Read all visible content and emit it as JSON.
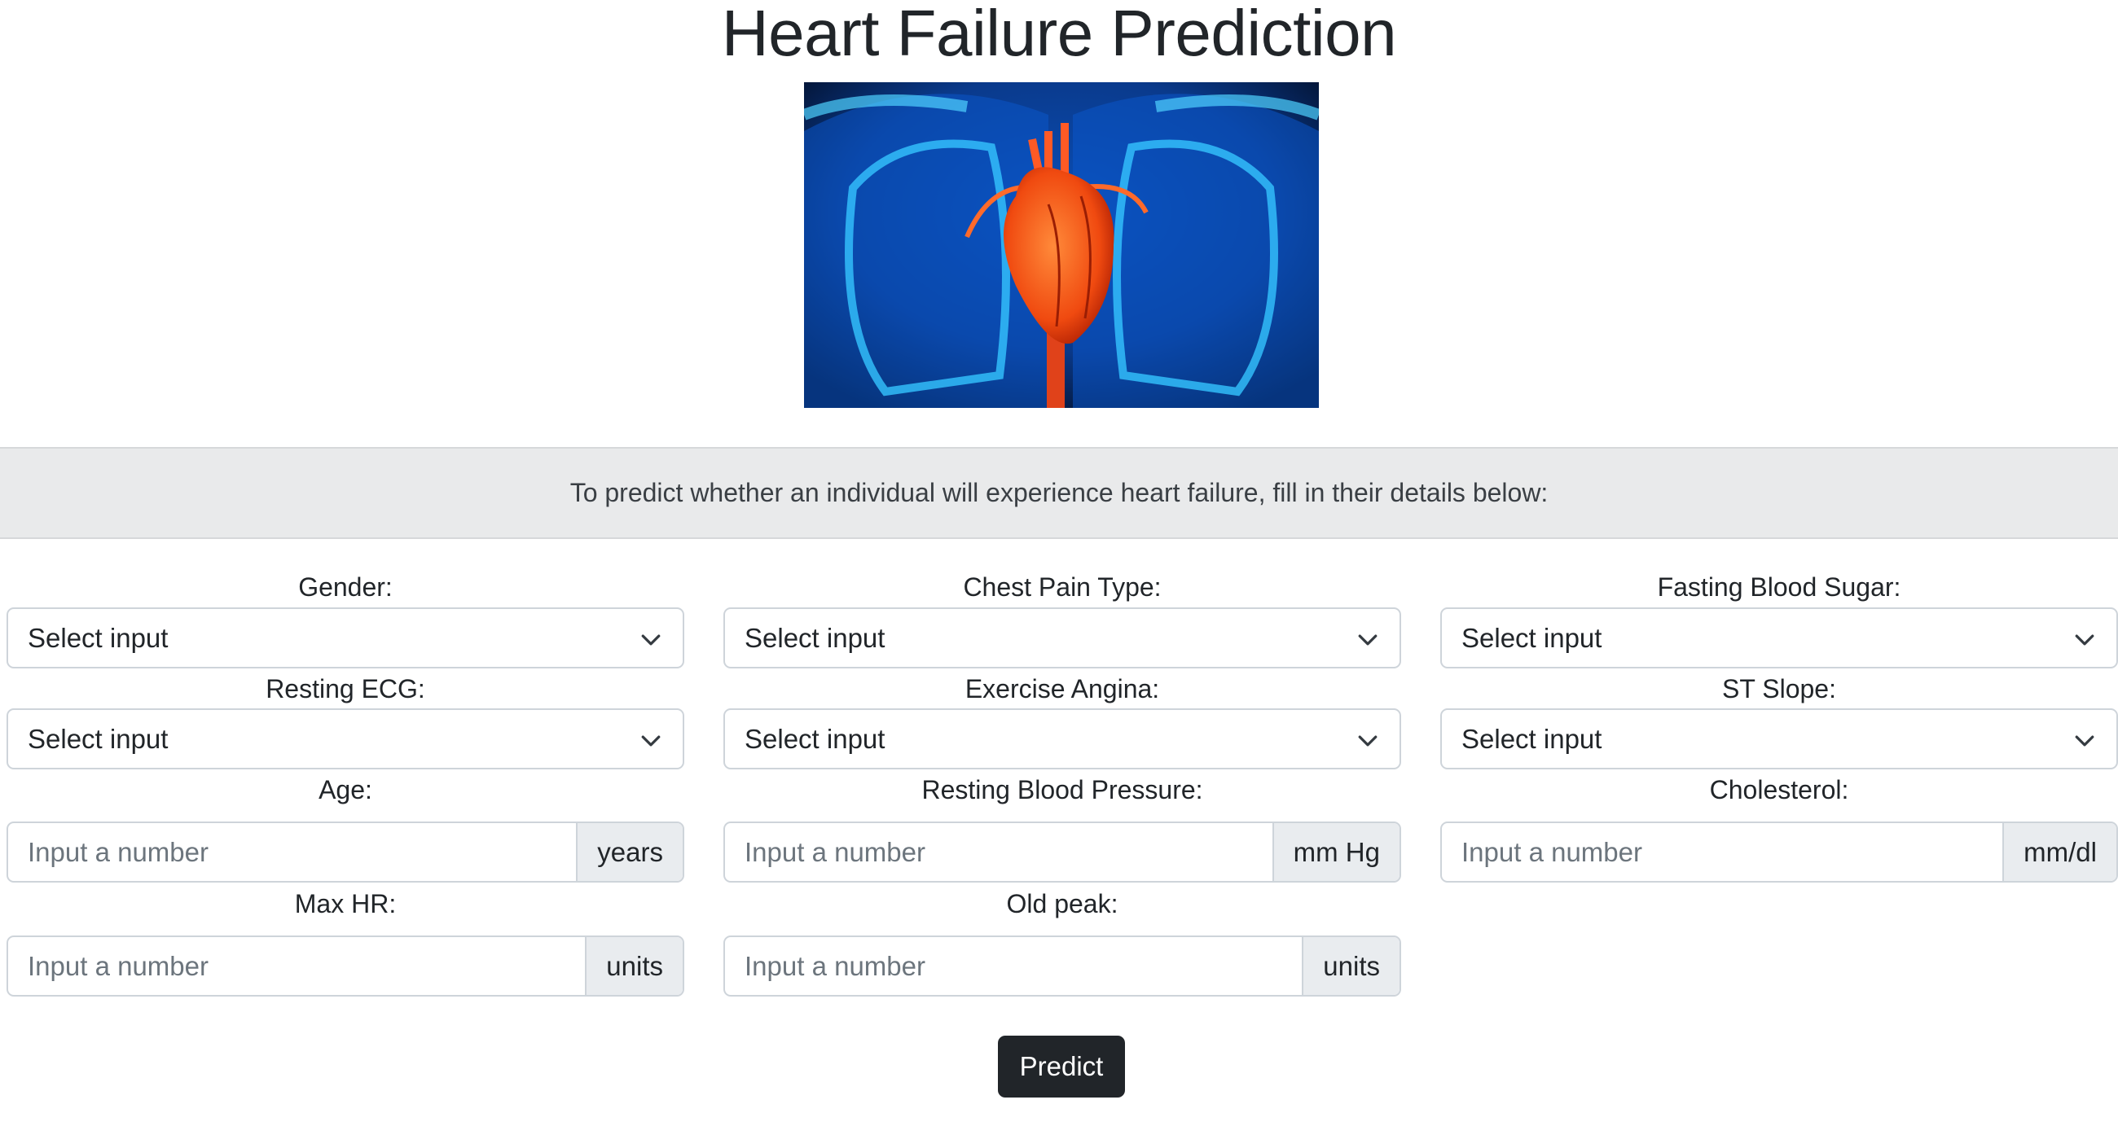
{
  "page": {
    "title": "Heart Failure Prediction",
    "hero_image": "heart-anatomy-illustration",
    "banner_text": "To predict whether an individual will experience heart failure, fill in their details below:"
  },
  "form": {
    "gender": {
      "label": "Gender:",
      "value": "Select input"
    },
    "chest_pain_type": {
      "label": "Chest Pain Type:",
      "value": "Select input"
    },
    "fasting_blood_sugar": {
      "label": "Fasting Blood Sugar:",
      "value": "Select input"
    },
    "resting_ecg": {
      "label": "Resting ECG:",
      "value": "Select input"
    },
    "exercise_angina": {
      "label": "Exercise Angina:",
      "value": "Select input"
    },
    "st_slope": {
      "label": "ST Slope:",
      "value": "Select input"
    },
    "age": {
      "label": "Age:",
      "placeholder": "Input a number",
      "unit": "years"
    },
    "resting_bp": {
      "label": "Resting Blood Pressure:",
      "placeholder": "Input a number",
      "unit": "mm Hg"
    },
    "cholesterol": {
      "label": "Cholesterol:",
      "placeholder": "Input a number",
      "unit": "mm/dl"
    },
    "max_hr": {
      "label": "Max HR:",
      "placeholder": "Input a number",
      "unit": "units"
    },
    "old_peak": {
      "label": "Old peak:",
      "placeholder": "Input a number",
      "unit": "units"
    }
  },
  "actions": {
    "predict_label": "Predict"
  },
  "colors": {
    "button": "#212529",
    "banner": "#e9eaeb",
    "border": "#ced4da"
  }
}
